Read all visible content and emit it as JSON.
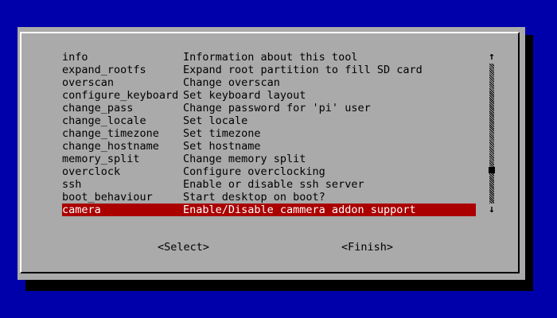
{
  "menu": {
    "items": [
      {
        "key": "info",
        "desc": "Information about this tool"
      },
      {
        "key": "expand_rootfs",
        "desc": "Expand root partition to fill SD card"
      },
      {
        "key": "overscan",
        "desc": "Change overscan"
      },
      {
        "key": "configure_keyboard",
        "desc": "Set keyboard layout"
      },
      {
        "key": "change_pass",
        "desc": "Change password for 'pi' user"
      },
      {
        "key": "change_locale",
        "desc": "Set locale"
      },
      {
        "key": "change_timezone",
        "desc": "Set timezone"
      },
      {
        "key": "change_hostname",
        "desc": "Set hostname"
      },
      {
        "key": "memory_split",
        "desc": "Change memory split"
      },
      {
        "key": "overclock",
        "desc": "Configure overclocking"
      },
      {
        "key": "ssh",
        "desc": "Enable or disable ssh server"
      },
      {
        "key": "boot_behaviour",
        "desc": "Start desktop on boot?"
      },
      {
        "key": "camera",
        "desc": "Enable/Disable cammera addon support",
        "selected": true
      }
    ]
  },
  "scrollbar": {
    "up_glyph": "↑",
    "down_glyph": "↓"
  },
  "buttons": {
    "select_label": "<Select>",
    "finish_label": "<Finish>"
  },
  "colors": {
    "background": "#0000AA",
    "dialog": "#AAAAAA",
    "highlight": "#AA0000",
    "highlight_text": "#FFFFFF"
  }
}
